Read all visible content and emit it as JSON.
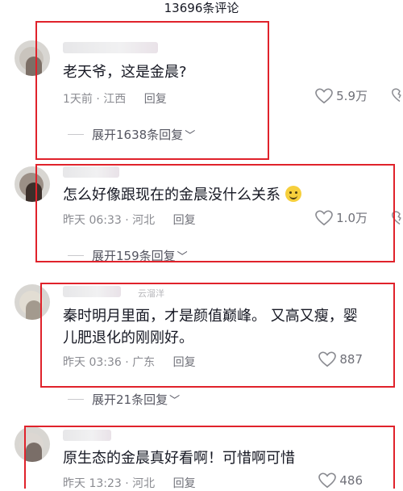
{
  "header": {
    "title": "13696条评论"
  },
  "comments": [
    {
      "text": "老天爷，这是金晨?",
      "time": "1天前",
      "location": "江西",
      "reply_label": "回复",
      "likes": "5.9万",
      "expand": "展开1638条回复"
    },
    {
      "text": "怎么好像跟现在的金晨没什么关系",
      "time": "昨天 06:33",
      "location": "河北",
      "reply_label": "回复",
      "likes": "1.0万",
      "expand": "展开159条回复",
      "emoji": "smile-emoji"
    },
    {
      "text_line1": "秦时明月里面，才是颜值巅峰。 又高又瘦，婴",
      "text_line2": "儿肥退化的刚刚好。",
      "time": "昨天 03:36",
      "location": "广东",
      "reply_label": "回复",
      "likes": "887",
      "expand": "展开21条回复",
      "username_tail": "云溜洋"
    },
    {
      "text": "原生态的金晨真好看啊！可惜啊可惜",
      "time": "昨天 13:23",
      "location": "河北",
      "reply_label": "回复",
      "likes": "486"
    }
  ],
  "colors": {
    "highlight": "#e0222b",
    "meta": "#8a8b91",
    "text": "#161823"
  }
}
